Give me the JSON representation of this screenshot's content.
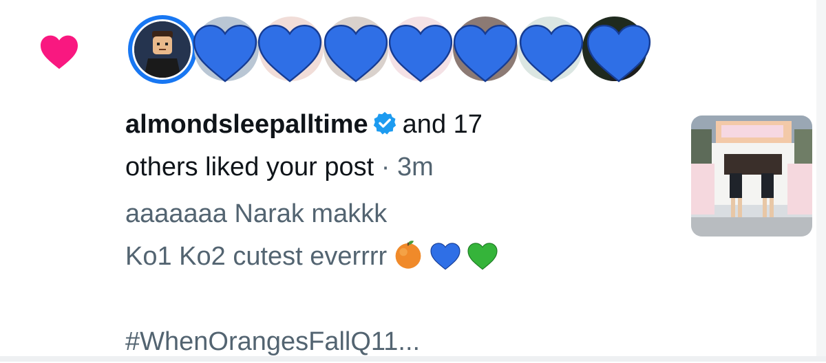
{
  "notification": {
    "type_icon": "heart-icon",
    "username": "almondsleepalltime",
    "verified_icon": "verified-badge-icon",
    "others_text": "and 17",
    "liked_text": "others liked your post",
    "separator": "·",
    "time": "3m"
  },
  "avatars": {
    "first": "user-avatar",
    "overlays": [
      "blue-heart-icon",
      "blue-heart-icon",
      "blue-heart-icon",
      "blue-heart-icon",
      "blue-heart-icon",
      "blue-heart-icon",
      "blue-heart-icon"
    ]
  },
  "post": {
    "line1": "aaaaaaa Narak makkk",
    "line2": "Ko1 Ko2 cutest everrrr",
    "line2_emojis": [
      "orange-emoji",
      "blue-heart-emoji",
      "green-heart-emoji"
    ],
    "hashtag": "#WhenOrangesFallQ11..."
  },
  "colors": {
    "like_pink": "#f91880",
    "heart_blue": "#2f6fe6",
    "heart_green": "#35b43a",
    "verified_blue": "#1d9bf0",
    "muted_text": "#536471"
  }
}
